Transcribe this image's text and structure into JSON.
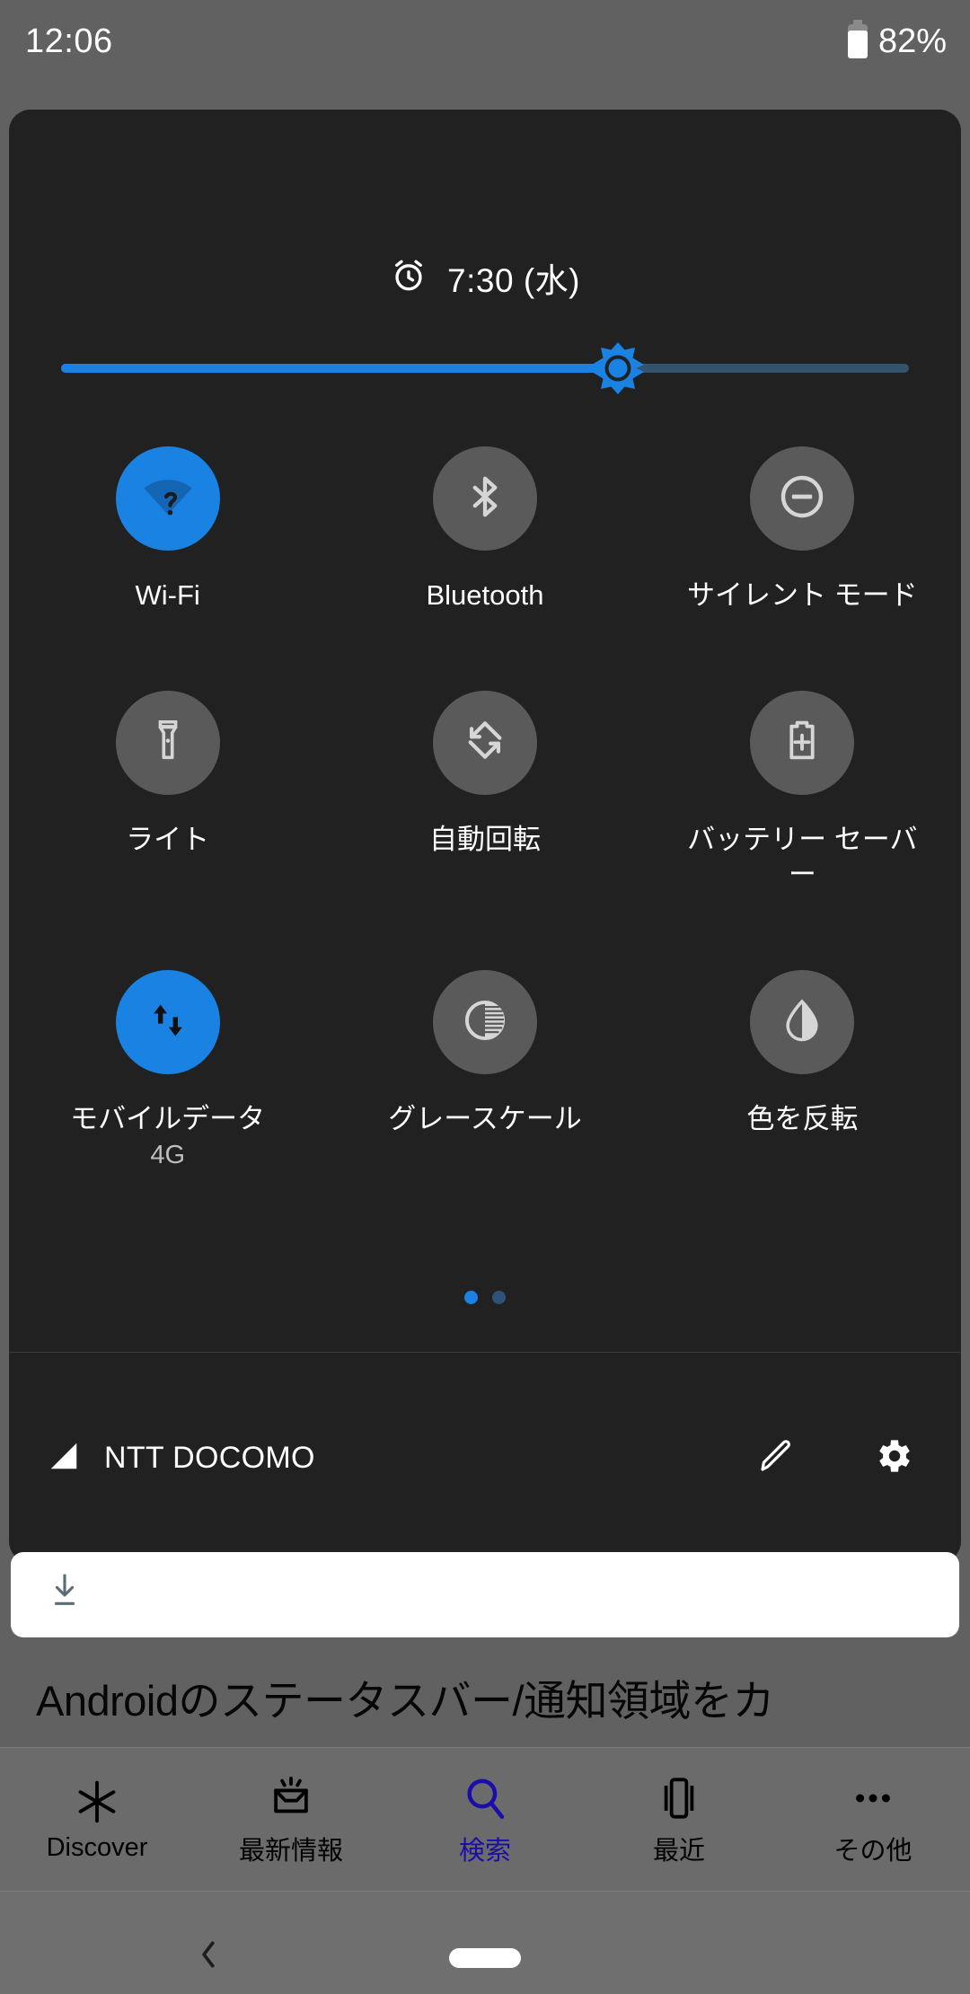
{
  "status_bar": {
    "time": "12:06",
    "battery_percent": "82%",
    "battery_icon": "battery-icon"
  },
  "quick_settings": {
    "alarm": {
      "icon": "alarm-clock-icon",
      "text": "7:30 (水)"
    },
    "brightness": {
      "name": "brightness-slider",
      "value_percent": 65,
      "thumb_icon": "brightness-sun-icon",
      "fill_color": "#1a82e2",
      "track_color": "#33536f"
    },
    "tiles": [
      {
        "id": "wifi",
        "label": "Wi-Fi",
        "sub": "",
        "icon": "wifi-question-icon",
        "active": true
      },
      {
        "id": "bluetooth",
        "label": "Bluetooth",
        "sub": "",
        "icon": "bluetooth-icon",
        "active": false
      },
      {
        "id": "silent-mode",
        "label": "サイレント モード",
        "sub": "",
        "icon": "do-not-disturb-icon",
        "active": false
      },
      {
        "id": "flashlight",
        "label": "ライト",
        "sub": "",
        "icon": "flashlight-icon",
        "active": false
      },
      {
        "id": "auto-rotate",
        "label": "自動回転",
        "sub": "",
        "icon": "auto-rotate-icon",
        "active": false
      },
      {
        "id": "battery-saver",
        "label": "バッテリー セーバー",
        "sub": "",
        "icon": "battery-saver-icon",
        "active": false
      },
      {
        "id": "mobile-data",
        "label": "モバイルデータ",
        "sub": "4G",
        "icon": "mobile-data-icon",
        "active": true
      },
      {
        "id": "grayscale",
        "label": "グレースケール",
        "sub": "",
        "icon": "grayscale-icon",
        "active": false
      },
      {
        "id": "invert-colors",
        "label": "色を反転",
        "sub": "",
        "icon": "invert-colors-icon",
        "active": false
      }
    ],
    "pages": {
      "count": 2,
      "current": 1
    },
    "footer": {
      "signal_icon": "signal-bar-icon",
      "carrier": "NTT DOCOMO",
      "edit_icon": "pencil-edit-icon",
      "settings_icon": "gear-icon"
    },
    "accent_color": "#1a82e2",
    "panel_color": "#212121",
    "tile_off_color": "#5a5a5a"
  },
  "notification_card": {
    "name": "download-notification",
    "icon": "download-arrow-icon"
  },
  "background_app": {
    "headline": "Androidのステータスバー/通知領域をカ",
    "tabs": [
      {
        "id": "discover",
        "label": "Discover",
        "icon": "asterisk-icon",
        "active": false
      },
      {
        "id": "updates",
        "label": "最新情報",
        "icon": "inbox-icon",
        "active": false
      },
      {
        "id": "search",
        "label": "検索",
        "icon": "search-icon",
        "active": true
      },
      {
        "id": "recent",
        "label": "最近",
        "icon": "tabs-icon",
        "active": false
      },
      {
        "id": "more",
        "label": "その他",
        "icon": "overflow-icon",
        "active": false
      }
    ],
    "nav": {
      "back_icon": "back-chevron-icon",
      "home_icon": "home-pill-icon"
    }
  }
}
